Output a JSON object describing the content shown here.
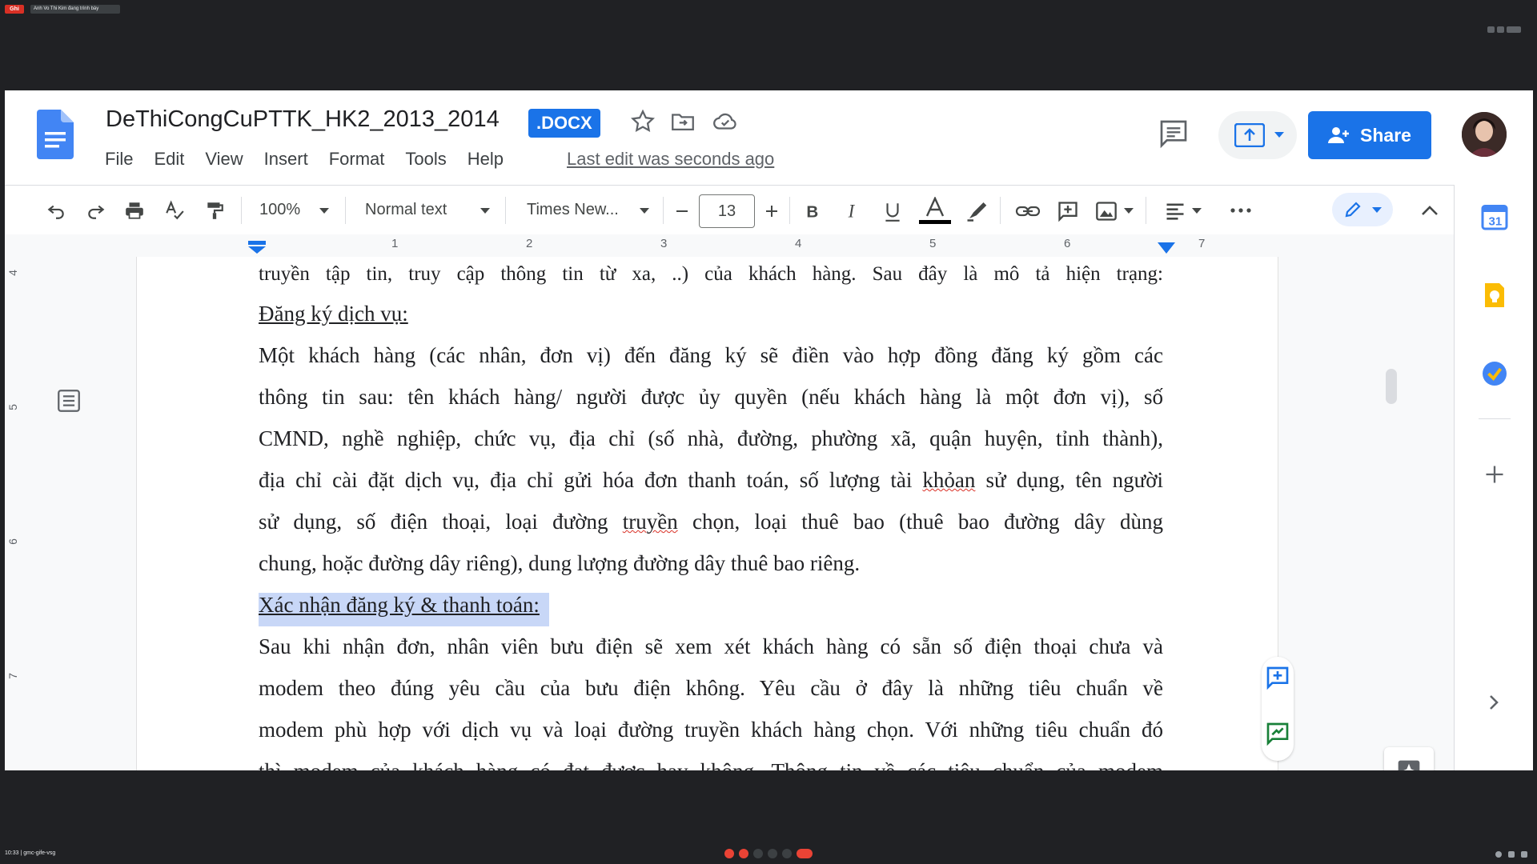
{
  "share_bar": {
    "rec_label": "Ghi",
    "tab_label": "Anh Vo Thi Kim đang trình bày"
  },
  "docs": {
    "title": "DeThiCongCuPTTK_HK2_2013_2014",
    "badge": ".DOCX",
    "menu": [
      "File",
      "Edit",
      "View",
      "Insert",
      "Format",
      "Tools",
      "Help"
    ],
    "last_edit": "Last edit was seconds ago",
    "share_label": "Share",
    "toolbar": {
      "zoom": "100%",
      "style": "Normal text",
      "font": "Times New...",
      "font_size": "13"
    },
    "ruler_numbers": [
      "1",
      "2",
      "3",
      "4",
      "5",
      "6",
      "7"
    ],
    "vruler_numbers": [
      "4",
      "5",
      "6",
      "7"
    ],
    "body": {
      "line0": "truyền tập tin, truy cập thông tin từ xa, ..) của khách hàng. Sau đây là mô tả hiện trạng:",
      "heading1": "Đăng ký dịch vụ:",
      "para1": [
        "Một khách hàng (các nhân, đơn vị) đến đăng ký sẽ điền vào hợp đồng đăng ký gồm các",
        "thông tin sau: tên khách hàng/ người được ủy quyền (nếu khách hàng là một đơn vị), số",
        "CMND, nghề nghiệp, chức vụ, địa chỉ (số nhà, đường, phường xã, quận huyện, tỉnh thành),",
        "địa chỉ cài đặt dịch vụ, địa chỉ gửi hóa đơn thanh toán, số lượng tài ",
        "khỏan",
        " sử dụng, tên người",
        "sử dụng, số điện thoại, loại đường ",
        "truyền",
        " chọn, loại thuê bao (thuê bao đường dây dùng",
        "chung, hoặc đường dây riêng), dung lượng đường dây thuê bao riêng."
      ],
      "heading2": "Xác nhận đăng ký & thanh toán:",
      "para2": [
        "Sau khi nhận đơn, nhân viên bưu điện sẽ xem xét khách hàng có sẵn số điện thoại chưa và",
        "modem theo đúng yêu cầu của bưu điện không. Yêu cầu ở đây là những tiêu chuẩn về",
        "modem phù hợp với dịch vụ và loại đường truyền khách hàng chọn. Với những tiêu chuẩn đó",
        "thì modem của khách hàng có đạt được hay không. Thông tin về các tiêu chuẩn của modem"
      ]
    }
  },
  "bottom_bar": {
    "time_meeting": "10:33 | gmc-gife-vsg"
  }
}
